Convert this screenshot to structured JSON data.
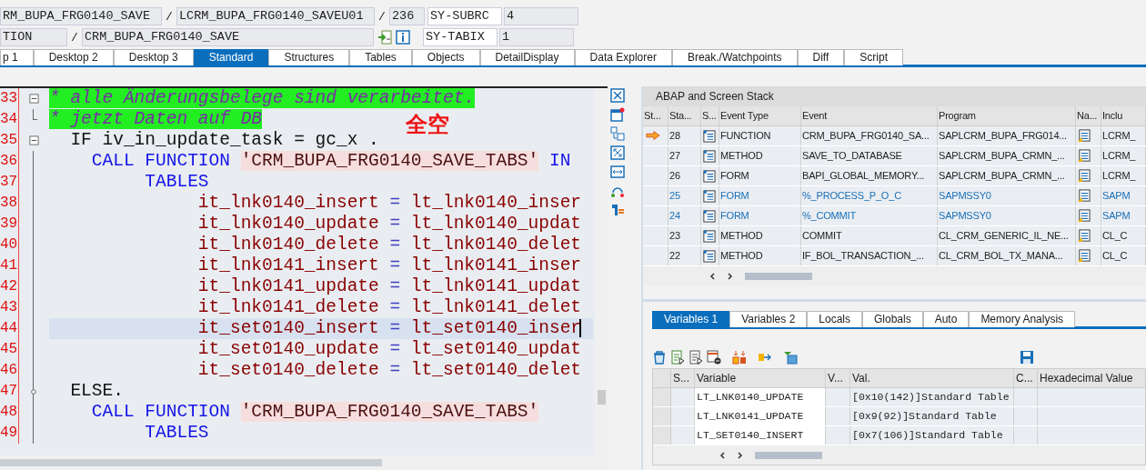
{
  "header": {
    "row1": {
      "program": "RM_BUPA_FRG0140_SAVE",
      "slash_1": "/",
      "include": "LCRM_BUPA_FRG0140_SAVEU01",
      "slash_2": "/",
      "line": "236",
      "sy_field": "SY-SUBRC",
      "sy_value": "4"
    },
    "row2": {
      "event_type": "TION",
      "slash": "/",
      "event": "CRM_BUPA_FRG0140_SAVE",
      "sy_field": "SY-TABIX",
      "sy_value": "1"
    }
  },
  "tabs": [
    {
      "label": "p 1",
      "selected": false
    },
    {
      "label": "Desktop 2",
      "selected": false
    },
    {
      "label": "Desktop 3",
      "selected": false
    },
    {
      "label": "Standard",
      "selected": true
    },
    {
      "label": "Structures",
      "selected": false
    },
    {
      "label": "Tables",
      "selected": false
    },
    {
      "label": "Objects",
      "selected": false
    },
    {
      "label": "DetailDisplay",
      "selected": false
    },
    {
      "label": "Data Explorer",
      "selected": false
    },
    {
      "label": "Break./Watchpoints",
      "selected": false
    },
    {
      "label": "Diff",
      "selected": false
    },
    {
      "label": "Script",
      "selected": false
    }
  ],
  "editor": {
    "annotation": "全空",
    "lines": [
      {
        "number": "33",
        "kind": "box",
        "current": false,
        "segments": [
          {
            "kind": "comment",
            "text": "* alle Änderungsbelege sind verarbeitet."
          }
        ]
      },
      {
        "number": "34",
        "kind": "end",
        "current": false,
        "segments": [
          {
            "kind": "comment",
            "text": "* jetzt Daten auf DB"
          }
        ]
      },
      {
        "number": "35",
        "kind": "box",
        "current": false,
        "segments": [
          {
            "kind": "plain",
            "text": "  IF iv_in_update_task = gc_x ."
          }
        ]
      },
      {
        "number": "36",
        "kind": "body",
        "current": false,
        "segments": [
          {
            "kind": "keyword",
            "text": "    CALL FUNCTION"
          },
          {
            "kind": "string",
            "text": "'CRM_BUPA_FRG0140_SAVE_TABS'"
          },
          {
            "kind": "keyword",
            "text": "IN"
          }
        ]
      },
      {
        "number": "37",
        "kind": "body",
        "current": false,
        "segments": [
          {
            "kind": "keyword",
            "text": "         TABLES"
          }
        ]
      },
      {
        "number": "38",
        "kind": "body",
        "current": false,
        "segments": [
          {
            "kind": "ident",
            "text": "              it_lnk0140_insert"
          },
          {
            "kind": "op",
            "text": "="
          },
          {
            "kind": "ident",
            "text": "lt_lnk0140_inser"
          }
        ]
      },
      {
        "number": "39",
        "kind": "body",
        "current": false,
        "segments": [
          {
            "kind": "ident",
            "text": "              it_lnk0140_update"
          },
          {
            "kind": "op",
            "text": "="
          },
          {
            "kind": "ident",
            "text": "lt_lnk0140_updat"
          }
        ]
      },
      {
        "number": "40",
        "kind": "body",
        "current": false,
        "segments": [
          {
            "kind": "ident",
            "text": "              it_lnk0140_delete"
          },
          {
            "kind": "op",
            "text": "="
          },
          {
            "kind": "ident",
            "text": "lt_lnk0140_delet"
          }
        ]
      },
      {
        "number": "41",
        "kind": "body",
        "current": false,
        "segments": [
          {
            "kind": "ident",
            "text": "              it_lnk0141_insert"
          },
          {
            "kind": "op",
            "text": "="
          },
          {
            "kind": "ident",
            "text": "lt_lnk0141_inser"
          }
        ]
      },
      {
        "number": "42",
        "kind": "body",
        "current": false,
        "segments": [
          {
            "kind": "ident",
            "text": "              it_lnk0141_update"
          },
          {
            "kind": "op",
            "text": "="
          },
          {
            "kind": "ident",
            "text": "lt_lnk0141_updat"
          }
        ]
      },
      {
        "number": "43",
        "kind": "body",
        "current": false,
        "segments": [
          {
            "kind": "ident",
            "text": "              it_lnk0141_delete"
          },
          {
            "kind": "op",
            "text": "="
          },
          {
            "kind": "ident",
            "text": "lt_lnk0141_delet"
          }
        ]
      },
      {
        "number": "44",
        "kind": "body",
        "current": true,
        "segments": [
          {
            "kind": "ident",
            "text": "              it_set0140_insert"
          },
          {
            "kind": "op",
            "text": "="
          },
          {
            "kind": "ident",
            "text": "lt_set0140_inser"
          }
        ]
      },
      {
        "number": "45",
        "kind": "body",
        "current": false,
        "segments": [
          {
            "kind": "ident",
            "text": "              it_set0140_update"
          },
          {
            "kind": "op",
            "text": "="
          },
          {
            "kind": "ident",
            "text": "lt_set0140_updat"
          }
        ]
      },
      {
        "number": "46",
        "kind": "body",
        "current": false,
        "segments": [
          {
            "kind": "ident",
            "text": "              it_set0140_delete"
          },
          {
            "kind": "op",
            "text": "="
          },
          {
            "kind": "ident",
            "text": "lt_set0140_delet"
          }
        ]
      },
      {
        "number": "47",
        "kind": "branch",
        "current": false,
        "segments": [
          {
            "kind": "plain",
            "text": "  ELSE."
          }
        ]
      },
      {
        "number": "48",
        "kind": "body",
        "current": false,
        "segments": [
          {
            "kind": "keyword",
            "text": "    CALL FUNCTION"
          },
          {
            "kind": "string",
            "text": "'CRM_BUPA_FRG0140_SAVE_TABS'"
          }
        ]
      },
      {
        "number": "49",
        "kind": "body",
        "current": false,
        "segments": [
          {
            "kind": "keyword",
            "text": "         TABLES"
          }
        ]
      }
    ]
  },
  "stack": {
    "title": "ABAP and Screen Stack",
    "columns": [
      "St...",
      "Sta...",
      "S...",
      "Event Type",
      "Event",
      "Program",
      "Na...",
      "Inclu"
    ],
    "rows": [
      {
        "current": true,
        "stack_no": "28",
        "event_type": "FUNCTION",
        "event": "CRM_BUPA_FRG0140_SA...",
        "program": "SAPLCRM_BUPA_FRG014...",
        "include": "LCRM_",
        "system": false
      },
      {
        "current": false,
        "stack_no": "27",
        "event_type": "METHOD",
        "event": "SAVE_TO_DATABASE",
        "program": "SAPLCRM_BUPA_CRMN_...",
        "include": "LCRM_",
        "system": false
      },
      {
        "current": false,
        "stack_no": "26",
        "event_type": "FORM",
        "event": "BAPI_GLOBAL_MEMORY...",
        "program": "SAPLCRM_BUPA_CRMN_...",
        "include": "LCRM_",
        "system": false
      },
      {
        "current": false,
        "stack_no": "25",
        "event_type": "FORM",
        "event": "%_PROCESS_P_O_C",
        "program": "SAPMSSY0",
        "include": "SAPM",
        "system": true
      },
      {
        "current": false,
        "stack_no": "24",
        "event_type": "FORM",
        "event": "%_COMMIT",
        "program": "SAPMSSY0",
        "include": "SAPM",
        "system": true
      },
      {
        "current": false,
        "stack_no": "23",
        "event_type": "METHOD",
        "event": "COMMIT",
        "program": "CL_CRM_GENERIC_IL_NE...",
        "include": "CL_C",
        "system": false
      },
      {
        "current": false,
        "stack_no": "22",
        "event_type": "METHOD",
        "event": "IF_BOL_TRANSACTION_...",
        "program": "CL_CRM_BOL_TX_MANA...",
        "include": "CL_C",
        "system": false
      }
    ]
  },
  "variables": {
    "tabs": [
      {
        "label": "Variables 1",
        "selected": true
      },
      {
        "label": "Variables 2",
        "selected": false
      },
      {
        "label": "Locals",
        "selected": false
      },
      {
        "label": "Globals",
        "selected": false
      },
      {
        "label": "Auto",
        "selected": false
      },
      {
        "label": "Memory Analysis",
        "selected": false
      }
    ],
    "columns": [
      "S...",
      "Variable",
      "V...",
      "Val.",
      "C...",
      "Hexadecimal Value"
    ],
    "rows": [
      {
        "variable": "LT_LNK0140_UPDATE",
        "value": "[0x10(142)]Standard Table"
      },
      {
        "variable": "LT_LNK0141_UPDATE",
        "value": "[0x9(92)]Standard Table"
      },
      {
        "variable": "LT_SET0140_INSERT",
        "value": "[0x7(106)]Standard Table"
      }
    ]
  }
}
